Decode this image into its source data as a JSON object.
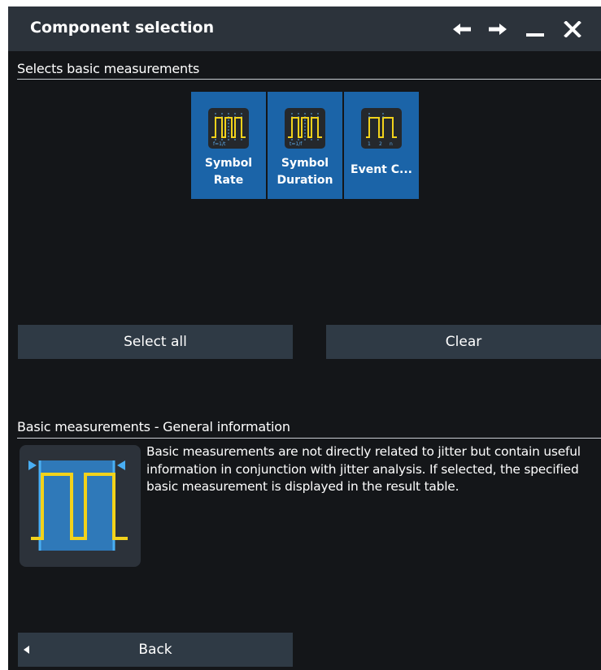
{
  "window": {
    "title": "Component selection",
    "icons": [
      "back-arrow-icon",
      "forward-arrow-icon",
      "minimize-icon",
      "close-icon"
    ]
  },
  "selection": {
    "heading": "Selects basic measurements",
    "tiles": [
      {
        "label_line1": "Symbol",
        "label_line2": "Rate",
        "icon": "symbol-rate-icon"
      },
      {
        "label_line1": "Symbol",
        "label_line2": "Duration",
        "icon": "symbol-duration-icon"
      },
      {
        "label_line1": "Event C...",
        "label_line2": "",
        "icon": "event-count-icon"
      }
    ]
  },
  "actions": {
    "select_all": "Select all",
    "clear": "Clear"
  },
  "info": {
    "heading": "Basic measurements - General information",
    "text": "Basic measurements are not directly related to jitter but contain useful information in conjunction with jitter analysis. If selected, the specified basic measurement is displayed in the result table.",
    "icon": "basic-measurements-icon"
  },
  "footer": {
    "back": "Back"
  },
  "colors": {
    "background": "#141619",
    "titlebar": "#2c333b",
    "tile_selected": "#1b64a8",
    "button": "#2f3a45",
    "signal_yellow": "#f2d21b",
    "marker_blue": "#3fa0ee"
  }
}
